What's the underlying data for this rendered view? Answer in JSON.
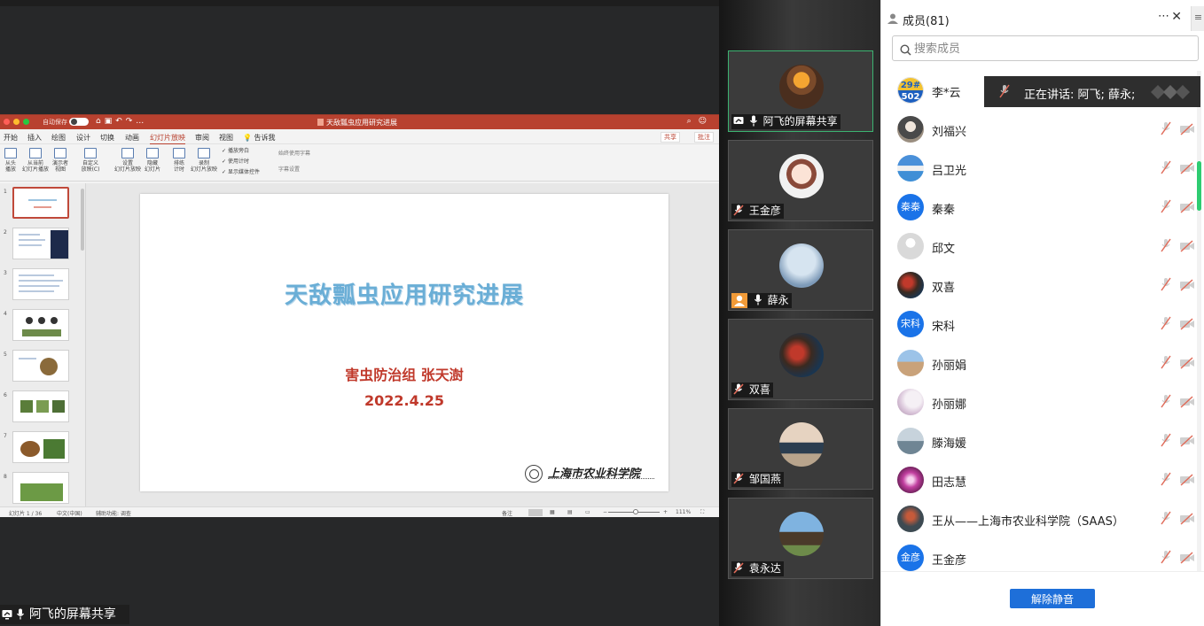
{
  "ppt": {
    "autosave": "自动保存",
    "doc_title": "天敌瓢虫应用研究进展",
    "tabs": [
      "开始",
      "插入",
      "绘图",
      "设计",
      "切换",
      "动画",
      "幻灯片放映",
      "审阅",
      "视图",
      "告诉我"
    ],
    "active_tab": "幻灯片放映",
    "share_btn": "共享",
    "comment_btn": "批注",
    "ribbon": {
      "from_start": "从头\n播放",
      "from_current": "从当前\n幻灯片播放",
      "presenter": "演示者\n视图",
      "custom": "自定义\n放映(C)",
      "setup": "设置\n幻灯片放映",
      "hide": "隐藏\n幻灯片",
      "rehearse": "排练\n计时",
      "record": "录制\n幻灯片放映",
      "check_1": "播放旁白",
      "check_2": "使用计时",
      "check_3": "显示媒体控件",
      "subtitle": "始终使用字幕",
      "subtitle_settings": "字幕设置"
    },
    "thumb_numbers": [
      "1",
      "2",
      "3",
      "4",
      "5",
      "6",
      "7",
      "8"
    ],
    "slide": {
      "title": "天敌瓢虫应用研究进展",
      "subtitle": "害虫防治组 张天澍",
      "date": "2022.4.25",
      "logo_text": "上海市农业科学院"
    },
    "status": {
      "slide_count": "幻灯片 1 / 36",
      "language": "中文(中国)",
      "accessibility": "辅助功能: 调查",
      "notes": "备注",
      "zoom": "111%"
    }
  },
  "share_label": "阿飞的屏幕共享",
  "video_tiles": [
    {
      "name": "阿飞的屏幕共享",
      "active": true
    },
    {
      "name": "王金彦",
      "active": false
    },
    {
      "name": "薛永",
      "active": false
    },
    {
      "name": "双喜",
      "active": false
    },
    {
      "name": "邹国燕",
      "active": false
    },
    {
      "name": "袁永达",
      "active": false
    }
  ],
  "panel": {
    "title": "成员(81)",
    "search_placeholder": "搜索成员",
    "speaking": "正在讲话: 阿飞; 薛永;",
    "unmute": "解除静音",
    "members": [
      {
        "name": "李*云",
        "avatar": "29#502",
        "color": "#1d5fbf"
      },
      {
        "name": "刘福兴",
        "avatar": "",
        "color": "#4a4a4a"
      },
      {
        "name": "吕卫光",
        "avatar": "",
        "color": "#3f8fd6"
      },
      {
        "name": "秦秦",
        "avatar": "秦秦",
        "color": "#1a73e8"
      },
      {
        "name": "邱文",
        "avatar": "",
        "color": "#cfcfcf"
      },
      {
        "name": "双喜",
        "avatar": "",
        "color": "#8a2a22"
      },
      {
        "name": "宋科",
        "avatar": "宋科",
        "color": "#1a73e8"
      },
      {
        "name": "孙丽娟",
        "avatar": "",
        "color": "#c9a27a"
      },
      {
        "name": "孙丽娜",
        "avatar": "",
        "color": "#e6d9e8"
      },
      {
        "name": "滕海媛",
        "avatar": "",
        "color": "#8fa3b0"
      },
      {
        "name": "田志慧",
        "avatar": "",
        "color": "#c23fa0"
      },
      {
        "name": "王从——上海市农业科学院（SAAS）",
        "avatar": "",
        "color": "#3d4a52"
      },
      {
        "name": "王金彦",
        "avatar": "金彦",
        "color": "#1a73e8"
      }
    ]
  },
  "colors": {
    "ppt_accent": "#b8412f",
    "slide_title": "#6aaed6",
    "slide_red": "#c0392b",
    "active_tile": "#3cb371",
    "primary_button": "#1e6fd9",
    "mute_icon": "#e06c5a"
  },
  "icons": {
    "mic": "microphone-icon",
    "mic_muted": "microphone-muted-icon",
    "cam_off": "camera-off-icon",
    "screen": "screen-share-icon",
    "search": "search-icon",
    "user": "user-icon"
  }
}
